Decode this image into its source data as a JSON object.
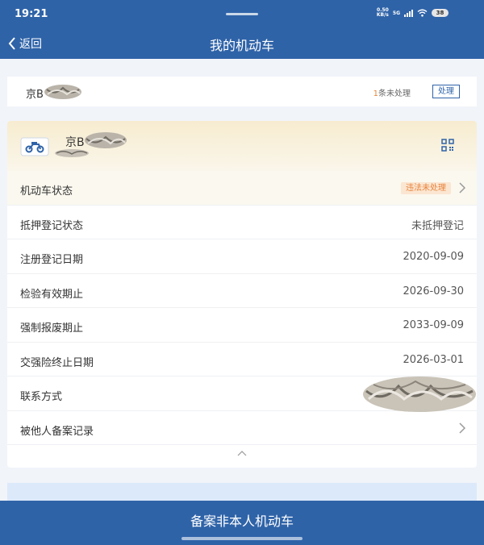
{
  "status_bar": {
    "time": "19:21",
    "net_speed_value": "0.50",
    "net_speed_unit": "KB/s",
    "network": "5G",
    "battery": "38"
  },
  "nav": {
    "back_label": "返回",
    "title": "我的机动车"
  },
  "plate_card": {
    "plate_prefix": "京B",
    "pending_count": "1",
    "pending_suffix": "条未处理",
    "handle_label": "处理"
  },
  "vehicle": {
    "plate_prefix": "京B",
    "status_badge": "违法未处理",
    "rows": [
      {
        "label": "机动车状态",
        "value": ""
      },
      {
        "label": "抵押登记状态",
        "value": "未抵押登记"
      },
      {
        "label": "注册登记日期",
        "value": "2020-09-09"
      },
      {
        "label": "检验有效期止",
        "value": "2026-09-30"
      },
      {
        "label": "强制报废期止",
        "value": "2033-09-09"
      },
      {
        "label": "交强险终止日期",
        "value": "2026-03-01"
      },
      {
        "label": "联系方式",
        "value": ""
      },
      {
        "label": "被他人备案记录",
        "value": ""
      }
    ]
  },
  "bottom_button": {
    "label": "备案非本人机动车"
  },
  "colors": {
    "brand": "#2f63a8",
    "warning": "#e8833a",
    "header_gradient": "#f7ecd0"
  },
  "icons": {
    "back": "chevron-left-icon",
    "vehicle": "motorcycle-icon",
    "qr": "qr-code-icon",
    "row_arrow": "chevron-right-icon",
    "collapse": "chevron-up-icon"
  }
}
